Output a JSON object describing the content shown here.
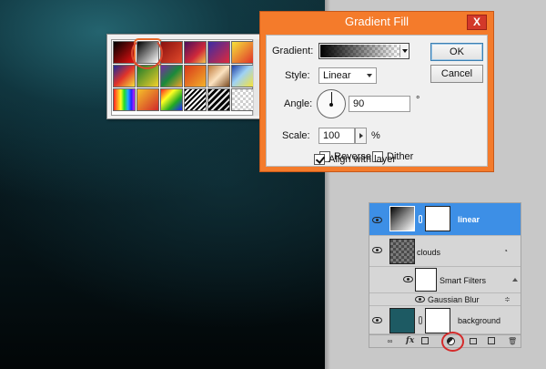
{
  "dialog": {
    "title": "Gradient Fill",
    "close_label": "X",
    "gradient_label": "Gradient:",
    "style_label": "Style:",
    "style_value": "Linear",
    "angle_label": "Angle:",
    "angle_value": "90",
    "angle_unit": "°",
    "scale_label": "Scale:",
    "scale_value": "100",
    "scale_unit": "%",
    "reverse_label": "Reverse",
    "reverse_checked": false,
    "dither_label": "Dither",
    "dither_checked": false,
    "align_label": "Align with layer",
    "align_checked": true,
    "ok_label": "OK",
    "cancel_label": "Cancel"
  },
  "picker": {
    "swatches": [
      "linear-gradient(135deg,#000 0%,#e11 100%)",
      "linear-gradient(135deg,#000 0%,rgba(0,0,0,0) 100%)",
      "linear-gradient(135deg,#8a1010 0%,#e24a2a 100%)",
      "linear-gradient(135deg,#4b0d5c 0%,#d12a3a 60%,#f3c44a 100%)",
      "linear-gradient(135deg,#3a2ba6 0%,#e02a3a 100%)",
      "linear-gradient(135deg,#f5e23a 0%,#e0332a 100%)",
      "linear-gradient(135deg,#1b2a9a 0%,#e0332a 50%,#f5e23a 100%)",
      "linear-gradient(135deg,#1a7a2a 0%,#f3d12a 100%)",
      "linear-gradient(135deg,#7a2aa6 0%,#1a8a3a 50%,#f5a02a 100%)",
      "linear-gradient(135deg,#d8361a 0%,#f3b12a 100%)",
      "linear-gradient(135deg,#c07a3a 0%,#fbe2c0 50%,#7a4a20 100%)",
      "linear-gradient(135deg,#1f3fa6 0%,#9fd2f5 45%,#f5e23a 100%)",
      "linear-gradient(90deg,#f22 0%,#f92 18%,#ff2 34%,#2d2 50%,#2af 68%,#22f 84%,#c2f 100%)",
      "linear-gradient(135deg,#f5c12a 0%,#d12a2a 100%)",
      "linear-gradient(135deg,#f22 0%,#ff2 33%,#2a2 66%,#22f 100%)",
      "repeating-linear-gradient(135deg,#000 0 2px,#fff 2px 4px)",
      "repeating-linear-gradient(135deg,#000 0 3px,#e6e6e6 3px 5px)",
      "repeating-conic-gradient(#cfcfcf 0% 25%,#ffffff 0% 50%) 0 0 / 6px 6px"
    ]
  },
  "layers": {
    "rows": [
      {
        "name": "linear"
      },
      {
        "name": "clouds"
      },
      {
        "name": "Smart Filters"
      },
      {
        "name": "Gaussian Blur"
      },
      {
        "name": "background"
      }
    ],
    "selected_color": "#3d8fe6"
  },
  "colors": {
    "dialog_frame": "#f47b2b",
    "highlight": "#d42b2b"
  }
}
